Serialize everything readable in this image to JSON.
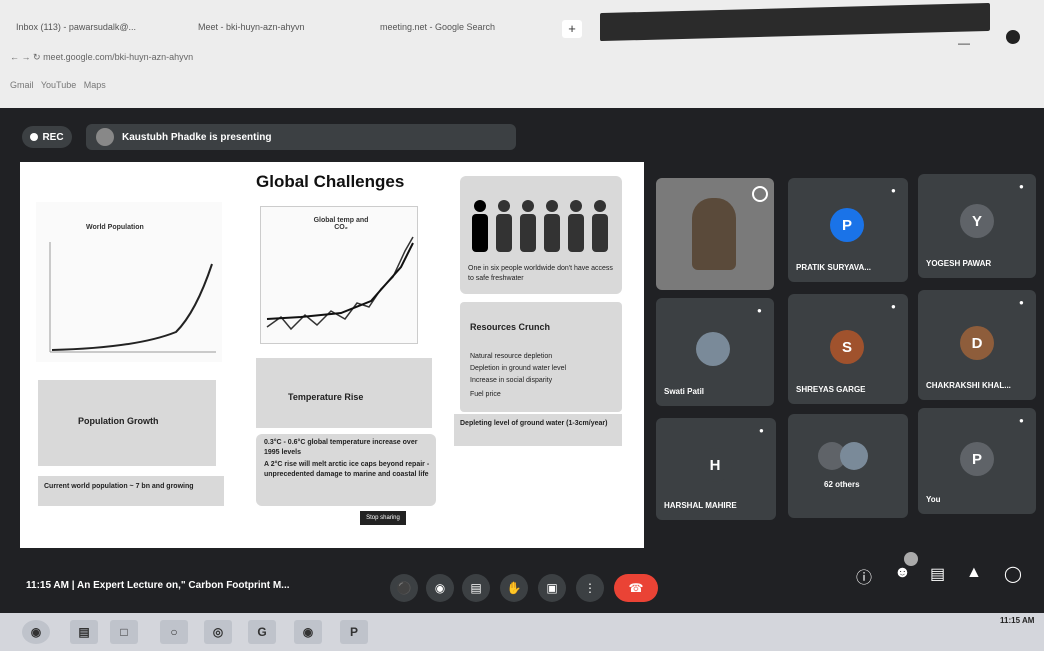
{
  "browser": {
    "tabs": [
      "Inbox (113) - pawarsudalk@...",
      "Meet - bki-huyn-azn-ahyvn",
      "meeting.net - Google Search"
    ],
    "address": "meet.google.com/bki-huyn-azn-ahyvn",
    "bookmarks": [
      "Gmail",
      "YouTube",
      "Maps"
    ]
  },
  "meet": {
    "rec_label": "REC",
    "presenting_text": "Kaustubh Phadke is presenting",
    "time": "11:15 AM",
    "meeting_title": "An Expert Lecture on,\" Carbon Footprint M...",
    "taskbar_time": "11:15 AM"
  },
  "slide": {
    "title": "Global Challenges",
    "world_population_label": "World Population",
    "global_temp_label": "Global temp and CO₂",
    "population_growth": "Population Growth",
    "current_population": "Current world population ~ 7 bn and growing",
    "temperature_rise": "Temperature Rise",
    "temp_bullets": [
      "0.3°C - 0.6°C global temperature increase over 1995 levels",
      "A 2°C rise will melt arctic ice caps beyond repair - unprecedented damage to marine and coastal life"
    ],
    "water_scarcity": "One in six people worldwide don't have access to safe freshwater",
    "resources_crunch": "Resources Crunch",
    "resource_bullets": [
      "Natural resource depletion",
      "Depletion in ground water level",
      "Increase in social disparity",
      "Fuel price"
    ],
    "ground_water": "Depleting level of ground water (1-3cm/year)",
    "stop_sharing": "Stop sharing"
  },
  "participants": [
    {
      "name": "",
      "initial": "",
      "video": true
    },
    {
      "name": "PRATIK SURYAVA...",
      "initial": "P",
      "color": "#1a73e8"
    },
    {
      "name": "YOGESH PAWAR",
      "initial": "Y",
      "color": "#5f6368"
    },
    {
      "name": "Swati Patil",
      "initial": "",
      "color": "#7a8a99"
    },
    {
      "name": "SHREYAS GARGE",
      "initial": "S",
      "color": "#a0522d"
    },
    {
      "name": "CHAKRAKSHI KHAL...",
      "initial": "D",
      "color": "#8e5d3b"
    },
    {
      "name": "HARSHAL MAHIRE",
      "initial": "H",
      "color": "#3c4043"
    },
    {
      "name": "62 others",
      "initial": "",
      "color": "#5f6368"
    },
    {
      "name": "You",
      "initial": "P",
      "color": "#5f6368"
    }
  ],
  "colors": {
    "meet_bg": "#202124",
    "tile_bg": "#3c4043",
    "end_call": "#ea4335",
    "accent": "#1a73e8"
  }
}
